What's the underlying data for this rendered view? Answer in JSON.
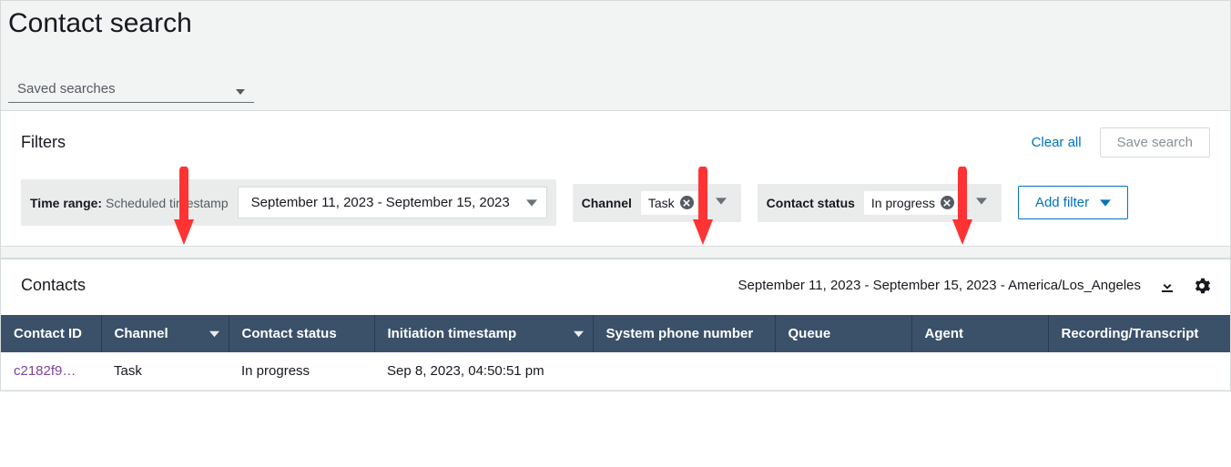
{
  "page_title": "Contact search",
  "saved_searches_label": "Saved searches",
  "filters": {
    "title": "Filters",
    "clear_all": "Clear all",
    "save_search": "Save search",
    "time_range": {
      "label_bold": "Time range:",
      "label_plain": " Scheduled timestamp",
      "value": "September 11, 2023 - September 15, 2023"
    },
    "channel": {
      "label": "Channel",
      "value": "Task"
    },
    "contact_status": {
      "label": "Contact status",
      "value": "In progress"
    },
    "add_filter": "Add filter"
  },
  "contacts": {
    "title": "Contacts",
    "date_range_tz": "September 11, 2023 - September 15, 2023 - America/Los_Angeles",
    "columns": [
      "Contact ID",
      "Channel",
      "Contact status",
      "Initiation timestamp",
      "System phone number",
      "Queue",
      "Agent",
      "Recording/Transcript"
    ],
    "rows": [
      {
        "contact_id": "c2182f9…",
        "channel": "Task",
        "contact_status": "In progress",
        "initiation_ts": "Sep 8, 2023, 04:50:51 pm",
        "system_phone": "",
        "queue": "",
        "agent": "",
        "recording": ""
      }
    ]
  },
  "annotations": {
    "arrow_color": "#ff3333"
  }
}
